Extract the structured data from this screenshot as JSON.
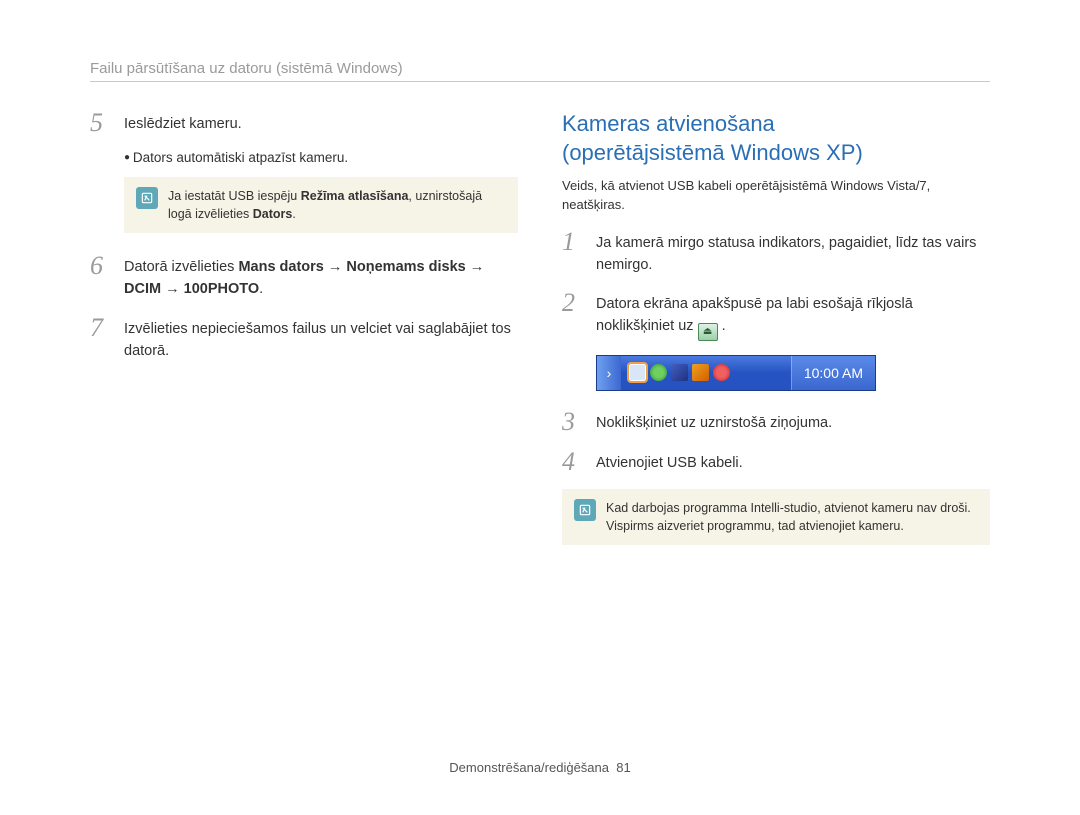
{
  "breadcrumb": "Failu pārsūtīšana uz datoru (sistēmā Windows)",
  "left": {
    "step5": {
      "num": "5",
      "text": "Ieslēdziet kameru."
    },
    "bullet": "Dators automātiski atpazīst kameru.",
    "note1_a": "Ja iestatāt USB iespēju ",
    "note1_b": "Režīma atlasīšana",
    "note1_c": ", uznirstošajā logā izvēlieties ",
    "note1_d": "Dators",
    "note1_e": ".",
    "step6": {
      "num": "6",
      "a": "Datorā izvēlieties ",
      "b": "Mans dators",
      "arr": " → ",
      "c": "Noņemams disks",
      "d": "DCIM",
      "e": "100PHOTO",
      "dot": "."
    },
    "step7": {
      "num": "7",
      "text": "Izvēlieties nepieciešamos failus un velciet vai saglabājiet tos datorā."
    }
  },
  "right": {
    "title_a": "Kameras atvienošana",
    "title_b": "(operētājsistēmā Windows XP)",
    "intro": "Veids, kā atvienot USB kabeli operētājsistēmā Windows Vista/7, neatšķiras.",
    "step1": {
      "num": "1",
      "text": "Ja kamerā mirgo statusa indikators, pagaidiet, līdz tas vairs nemirgo."
    },
    "step2": {
      "num": "2",
      "text": "Datora ekrāna apakšpusē pa labi esošajā rīkjoslā noklikšķiniet uz "
    },
    "time": "10:00 AM",
    "step3": {
      "num": "3",
      "text": "Noklikšķiniet uz uznirstošā ziņojuma."
    },
    "step4": {
      "num": "4",
      "text": "Atvienojiet USB kabeli."
    },
    "note2": "Kad darbojas programma Intelli-studio, atvienot kameru nav droši. Vispirms aizveriet programmu, tad atvienojiet kameru."
  },
  "footer": {
    "section": "Demonstrēšana/rediģēšana",
    "page": "81"
  }
}
